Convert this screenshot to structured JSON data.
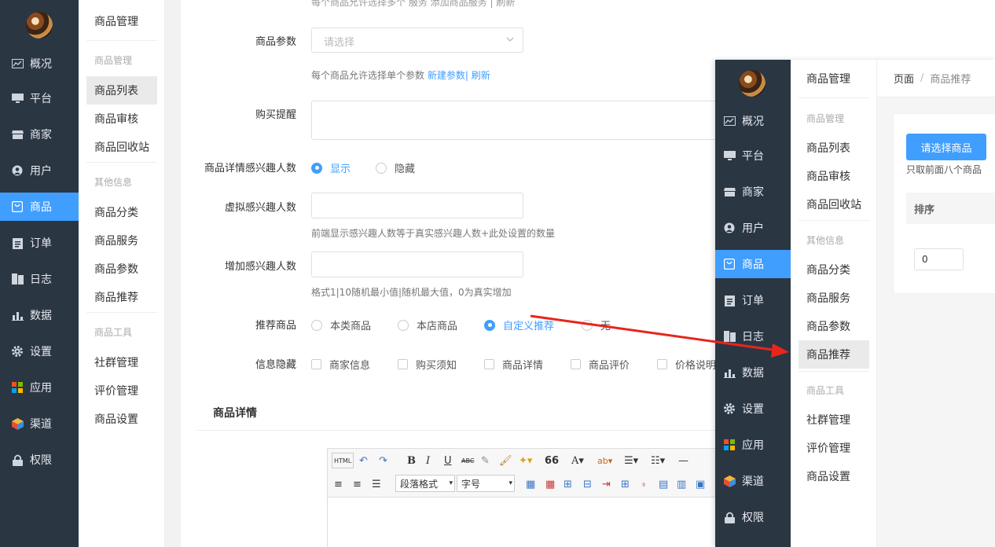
{
  "nav": [
    {
      "label": "概况",
      "icon": "overview-icon"
    },
    {
      "label": "平台",
      "icon": "monitor-icon"
    },
    {
      "label": "商家",
      "icon": "shop-icon"
    },
    {
      "label": "用户",
      "icon": "user-icon"
    },
    {
      "label": "商品",
      "icon": "goods-icon",
      "active": true
    },
    {
      "label": "订单",
      "icon": "order-icon"
    },
    {
      "label": "日志",
      "icon": "log-icon"
    },
    {
      "label": "数据",
      "icon": "data-icon"
    },
    {
      "label": "设置",
      "icon": "gear-icon"
    },
    {
      "label": "应用",
      "icon": "apps-icon"
    },
    {
      "label": "渠道",
      "icon": "channel-icon"
    },
    {
      "label": "权限",
      "icon": "lock-icon"
    }
  ],
  "submenu": {
    "title": "商品管理",
    "group1": "商品管理",
    "items1": [
      "商品列表",
      "商品审核",
      "商品回收站"
    ],
    "group2": "其他信息",
    "items2": [
      "商品分类",
      "商品服务",
      "商品参数",
      "商品推荐"
    ],
    "group3": "商品工具",
    "items3": [
      "社群管理",
      "评价管理",
      "商品设置"
    ]
  },
  "form": {
    "top_hint": "每个商品允许选择多个 服务 添加商品服务 | 刷新",
    "param_label": "商品参数",
    "param_placeholder": "请选择",
    "param_hint": "每个商品允许选择单个参数",
    "param_hint_new": "新建参数",
    "param_hint_refresh": "刷新",
    "remind_label": "购买提醒",
    "interest_label": "商品详情感兴趣人数",
    "interest_show": "显示",
    "interest_hide": "隐藏",
    "virtual_label": "虚拟感兴趣人数",
    "virtual_hint": "前端显示感兴趣人数等于真实感兴趣人数+此处设置的数量",
    "add_label": "增加感兴趣人数",
    "add_hint": "格式1|10随机最小值|随机最大值，0为真实增加",
    "rec_label": "推荐商品",
    "rec_options": [
      "本类商品",
      "本店商品",
      "自定义推荐",
      "无"
    ],
    "hide_label": "信息隐藏",
    "hide_options": [
      "商家信息",
      "购买须知",
      "商品详情",
      "商品评价",
      "价格说明"
    ],
    "detail_title": "商品详情"
  },
  "editor": {
    "html": "HTML",
    "bold": "B",
    "italic": "I",
    "underline": "U",
    "strike": "ABC",
    "quote": "66",
    "font_color": "A",
    "para_format": "段落格式",
    "font_size": "字号"
  },
  "overlay": {
    "crumb_root": "页面",
    "crumb_sep": "/",
    "crumb_current": "商品推荐",
    "select_button": "请选择商品",
    "hint": "只取前面八个商品",
    "col_sort": "排序",
    "sort_value": "0"
  },
  "colors": {
    "accent": "#409eff",
    "sidebar": "#2b3643",
    "arrow": "#e8251c"
  }
}
